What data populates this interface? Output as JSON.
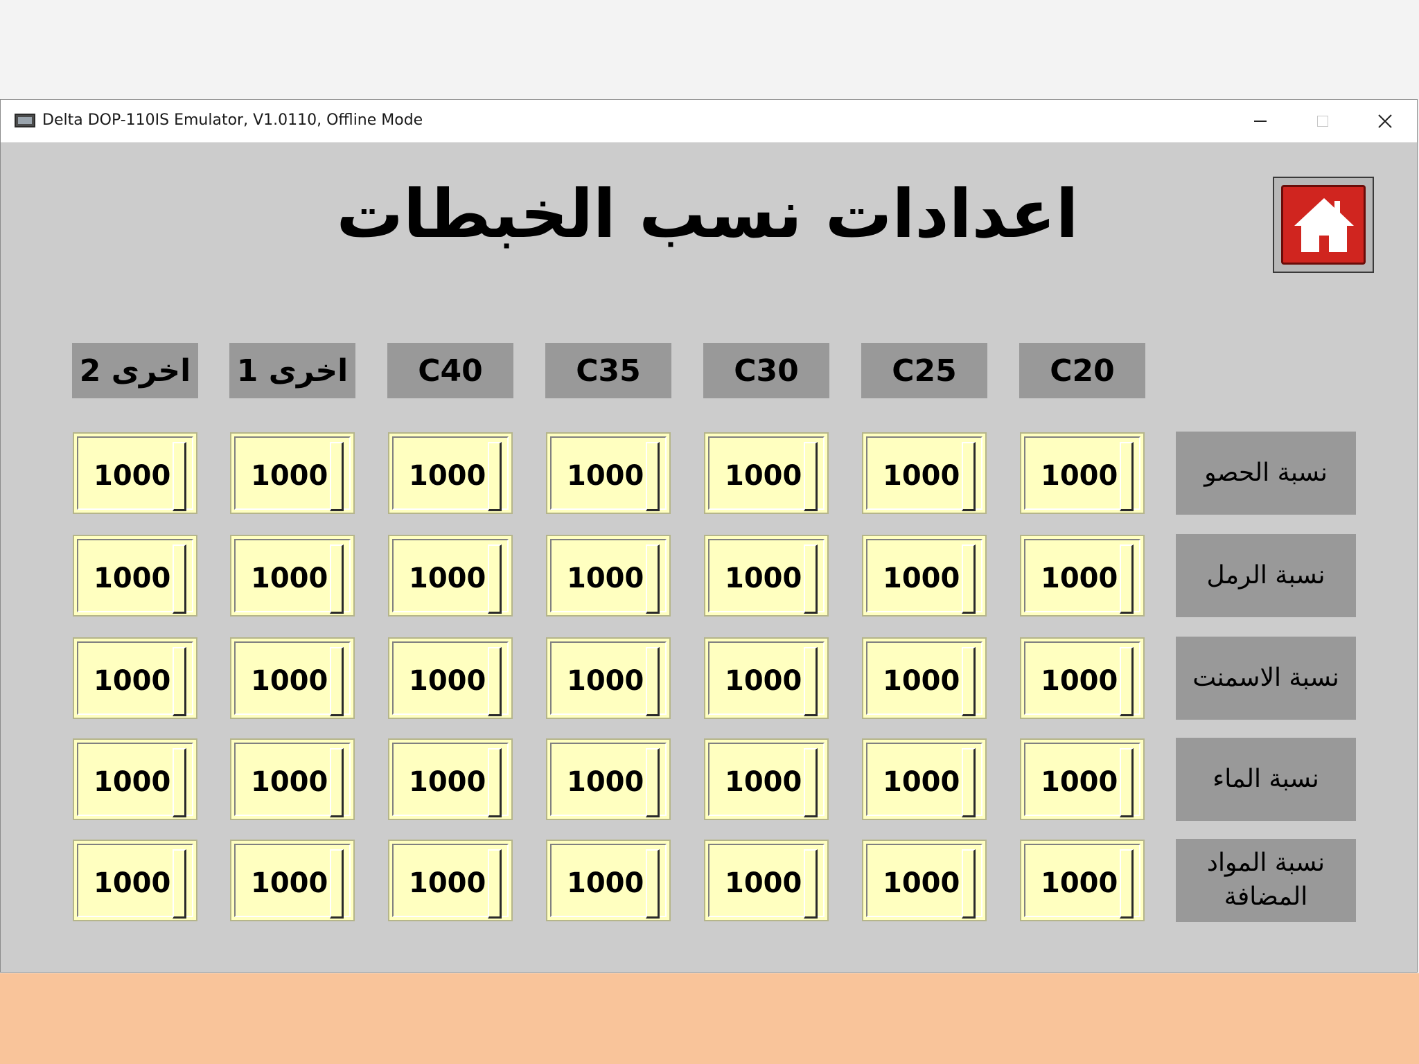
{
  "window": {
    "title": "Delta DOP-110IS Emulator, V1.0110, Offline Mode",
    "controls": {
      "minimize": "minimize-icon",
      "maximize": "maximize-icon",
      "close": "close-icon"
    }
  },
  "screen": {
    "title": "اعدادات نسب الخبطات",
    "home_button_icon": "home-icon",
    "colors": {
      "background": "#cccccc",
      "header_fill": "#999999",
      "cell_fill": "#ffffc0",
      "home_button": "#d0251f"
    },
    "column_headers": [
      "C20",
      "C25",
      "C30",
      "C35",
      "C40",
      "اخرى 1",
      "اخرى 2"
    ],
    "row_headers": [
      "نسبة الحصو",
      "نسبة الرمل",
      "نسبة الاسمنت",
      "نسبة الماء",
      "نسبة المواد المضافة"
    ],
    "values": [
      [
        "1000",
        "1000",
        "1000",
        "1000",
        "1000",
        "1000",
        "1000"
      ],
      [
        "1000",
        "1000",
        "1000",
        "1000",
        "1000",
        "1000",
        "1000"
      ],
      [
        "1000",
        "1000",
        "1000",
        "1000",
        "1000",
        "1000",
        "1000"
      ],
      [
        "1000",
        "1000",
        "1000",
        "1000",
        "1000",
        "1000",
        "1000"
      ],
      [
        "1000",
        "1000",
        "1000",
        "1000",
        "1000",
        "1000",
        "1000"
      ]
    ]
  }
}
